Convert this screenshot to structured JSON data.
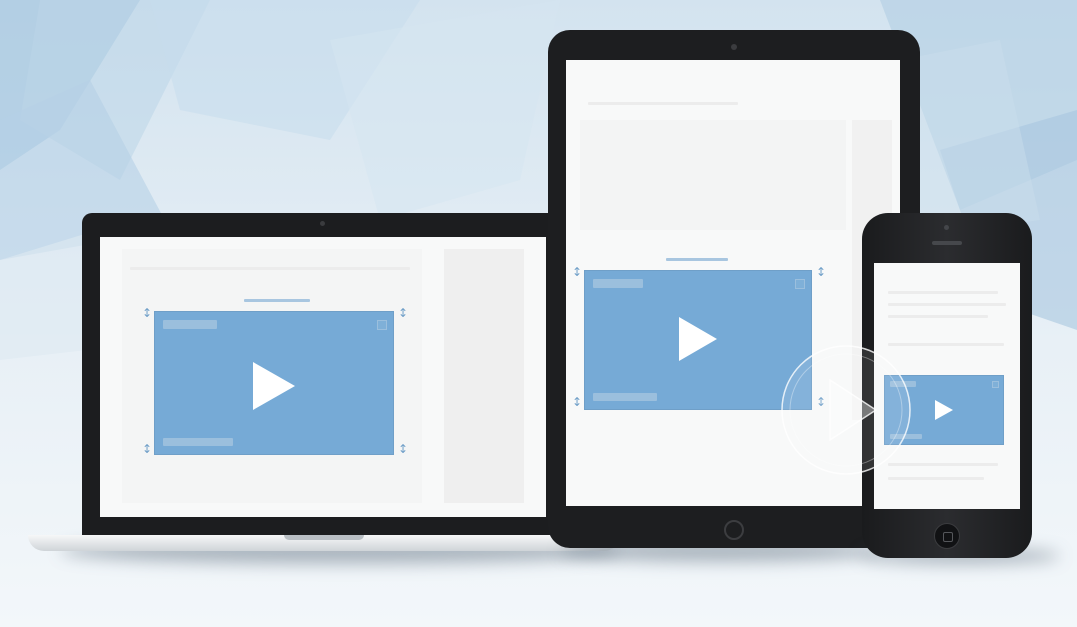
{
  "scene": {
    "devices": [
      "laptop",
      "tablet",
      "smartphone"
    ],
    "colors": {
      "background_light": "#eef4f8",
      "background_blue": "#c9dcea",
      "device_frame": "#1c1d1f",
      "screen": "#f8f9f9",
      "video_player": "#76aad6",
      "play_icon": "#ffffff"
    },
    "icons": {
      "laptop_video": "play-icon",
      "tablet_video": "play-icon",
      "phone_video": "play-icon",
      "overlay": "play-circle-watermark-icon"
    }
  }
}
